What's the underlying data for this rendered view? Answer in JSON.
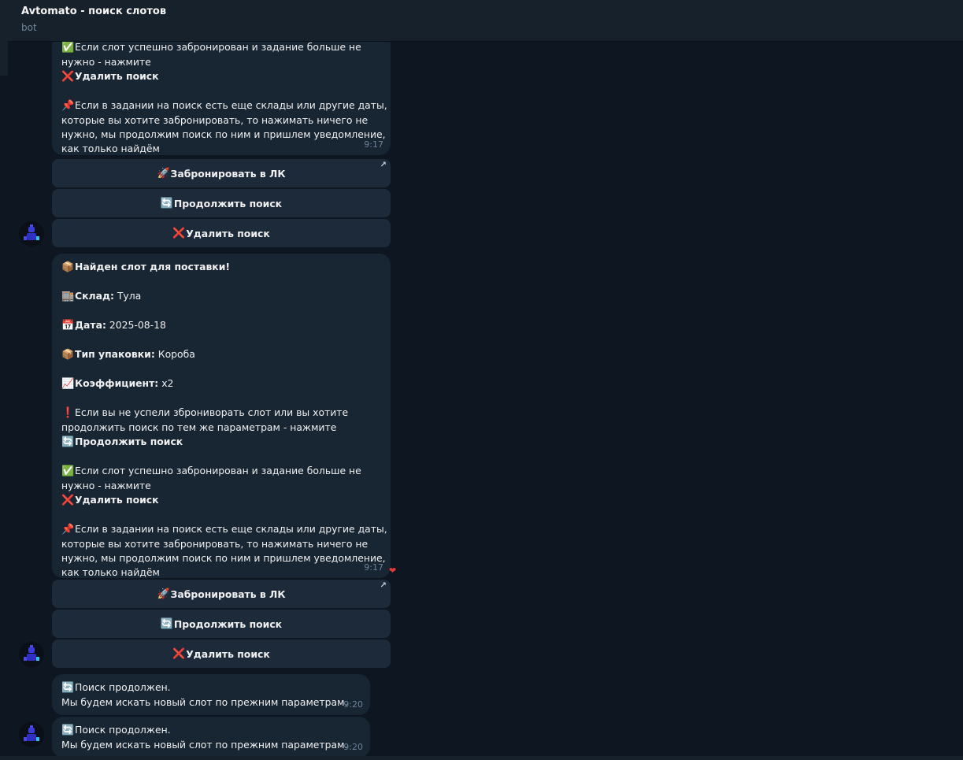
{
  "header": {
    "title": "Avtomato - поиск слотов",
    "subtitle": "bot"
  },
  "messages": {
    "m1": {
      "line1": "Если слот успешно забронирован и задание больше не",
      "line2": "нужно - нажмите",
      "line3": "Удалить поиск",
      "line5": "Если в задании на поиск есть еще склады или другие даты,",
      "line6": "которые вы хотите забронировать, то нажимать ничего не",
      "line7": "нужно, мы продолжим поиск по ним и пришлем уведомление,",
      "line8": "как только найдём",
      "time": "9:17"
    },
    "m2": {
      "title": "Найден слот для поставки!",
      "warehouse_label": "Склад:",
      "warehouse_value": "Тула",
      "date_label": "Дата:",
      "date_value": "2025-08-18",
      "pack_label": "Тип упаковки:",
      "pack_value": "Короба",
      "coef_label": "Коэффициент:",
      "coef_value": "x2",
      "warn1": "Если вы не успели зброниворать слот или вы хотите",
      "warn2": "продолжить поиск по тем же параметрам - нажмите",
      "continue": "Продолжить поиск",
      "ok1": "Если слот успешно забронирован и задание больше не",
      "ok2": "нужно - нажмите",
      "delete": "Удалить поиск",
      "pin1": "Если в задании на поиск есть еще склады или другие даты,",
      "pin2": "которые вы хотите забронировать, то нажимать ничего не",
      "pin3": "нужно, мы продолжим поиск по ним и пришлем уведомление,",
      "pin4": "как только найдём",
      "time": "9:17"
    },
    "m3": {
      "line1": "Поиск продолжен.",
      "line2": "Мы будем искать новый слот по прежним параметрам.",
      "time": "9:20"
    },
    "m4": {
      "line1": "Поиск продолжен.",
      "line2": "Мы будем искать новый слот по прежним параметрам.",
      "time": "9:20"
    }
  },
  "buttons": {
    "book": "Забронировать в ЛК",
    "continue": "Продолжить поиск",
    "delete": "Удалить поиск"
  },
  "icons": {
    "check": "check-mark-icon",
    "cross": "cross-mark-icon",
    "pin": "pushpin-icon",
    "package": "package-icon",
    "building": "building-icon",
    "calendar": "calendar-icon",
    "chart": "chart-increasing-icon",
    "exclamation": "exclamation-icon",
    "repeat": "repeat-icon",
    "rocket": "rocket-icon",
    "heart": "heart-icon"
  },
  "colors": {
    "background": "#0e1621",
    "bubble": "#182533",
    "button": "#1c2a3a",
    "header": "#17212b",
    "time": "#6d8299",
    "heart": "#e53935"
  }
}
